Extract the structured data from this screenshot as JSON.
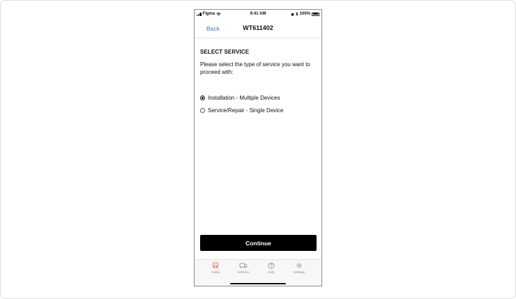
{
  "status_bar": {
    "carrier": "Figma",
    "time": "9:41 AM",
    "battery": "100%"
  },
  "nav": {
    "back_label": "Back",
    "title": "WT611402"
  },
  "content": {
    "section_title": "SELECT SERVICE",
    "instructions": "Please select the type of service you want to proceed with:",
    "options": [
      {
        "label": "Installation - Multiple Devices",
        "selected": true
      },
      {
        "label": "Service/Repair - Single Device",
        "selected": false
      }
    ]
  },
  "continue_label": "Continue",
  "tabs": [
    {
      "label": "Home",
      "icon": "home-icon",
      "active": true
    },
    {
      "label": "Vehicles",
      "icon": "truck-icon",
      "active": false
    },
    {
      "label": "Help",
      "icon": "help-icon",
      "active": false
    },
    {
      "label": "Settings",
      "icon": "gear-icon",
      "active": false
    }
  ],
  "colors": {
    "accent_link": "#2f7fd0",
    "active_tab": "#e2523d",
    "primary_button": "#000000"
  }
}
